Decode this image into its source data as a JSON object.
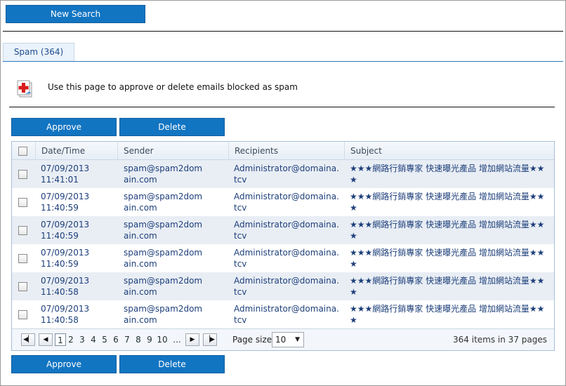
{
  "toolbar": {
    "new_search_label": "New Search"
  },
  "tabs": [
    {
      "label": "Spam (364)"
    }
  ],
  "info": {
    "text": "Use this page to approve or delete emails blocked as spam"
  },
  "actions": {
    "approve_label": "Approve",
    "delete_label": "Delete"
  },
  "grid": {
    "columns": [
      "Date/Time",
      "Sender",
      "Recipients",
      "Subject"
    ],
    "rows": [
      {
        "datetime": "07/09/2013 11:41:01",
        "sender": "spam@spam2domain.com",
        "recipients": "Administrator@domaina.tcv",
        "subject": "★★★網路行銷專家 快速曝光產品 增加網站流量★★★"
      },
      {
        "datetime": "07/09/2013 11:40:59",
        "sender": "spam@spam2domain.com",
        "recipients": "Administrator@domaina.tcv",
        "subject": "★★★網路行銷專家 快速曝光產品 增加網站流量★★★"
      },
      {
        "datetime": "07/09/2013 11:40:59",
        "sender": "spam@spam2domain.com",
        "recipients": "Administrator@domaina.tcv",
        "subject": "★★★網路行銷專家 快速曝光產品 增加網站流量★★★"
      },
      {
        "datetime": "07/09/2013 11:40:59",
        "sender": "spam@spam2domain.com",
        "recipients": "Administrator@domaina.tcv",
        "subject": "★★★網路行銷專家 快速曝光產品 增加網站流量★★★"
      },
      {
        "datetime": "07/09/2013 11:40:58",
        "sender": "spam@spam2domain.com",
        "recipients": "Administrator@domaina.tcv",
        "subject": "★★★網路行銷專家 快速曝光產品 增加網站流量★★★"
      },
      {
        "datetime": "07/09/2013 11:40:58",
        "sender": "spam@spam2domain.com",
        "recipients": "Administrator@domaina.tcv",
        "subject": "★★★網路行銷專家 快速曝光產品 增加網站流量★★★"
      }
    ]
  },
  "pager": {
    "pages": [
      "1",
      "2",
      "3",
      "4",
      "5",
      "6",
      "7",
      "8",
      "9",
      "10",
      "..."
    ],
    "current_page": "1",
    "page_size_label": "Page size:",
    "page_size": "10",
    "summary": "364 items in 37 pages",
    "icons": {
      "first": "first-page-icon",
      "prev": "prev-page-icon",
      "next": "next-page-icon",
      "last": "last-page-icon"
    }
  },
  "colors": {
    "button": "#1275c2",
    "tab_accent": "#2b79c1",
    "row_alt": "#e9eef5",
    "link_text": "#1d3f7a"
  }
}
